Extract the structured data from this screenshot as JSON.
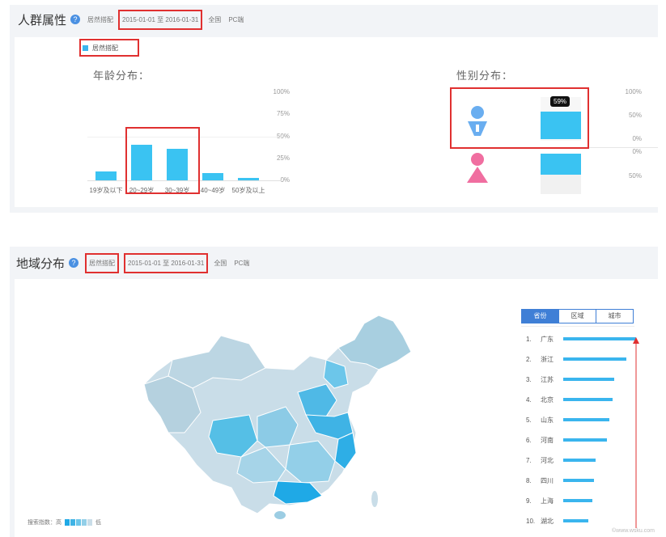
{
  "crowd": {
    "title": "人群属性",
    "help_icon": "question-icon",
    "keyword": "居然搭配",
    "date_range": "2015-01-01 至 2016-01-31",
    "region": "全国",
    "platform": "PC端",
    "legend": "居然搭配"
  },
  "age": {
    "section_title": "年龄分布：",
    "y_ticks": [
      "100%",
      "75%",
      "50%",
      "25%",
      "0%"
    ],
    "chart_data": {
      "type": "bar",
      "categories": [
        "19岁及以下",
        "20~29岁",
        "30~39岁",
        "40~49岁",
        "50岁及以上"
      ],
      "values": [
        10,
        40,
        36,
        8,
        3
      ],
      "ylim": [
        0,
        100
      ]
    }
  },
  "gender": {
    "section_title": "性别分布：",
    "y_ticks_top": [
      "100%",
      "50%",
      "0%"
    ],
    "y_ticks_bottom": [
      "0%",
      "50%"
    ],
    "tooltip": "59%",
    "male_share": 59,
    "icons": [
      "male-icon",
      "female-icon"
    ],
    "colors": {
      "male": "#6aaef0",
      "female": "#f06ea0",
      "bar": "#3ac3f2"
    }
  },
  "region": {
    "title": "地域分布",
    "help_icon": "question-icon",
    "keyword": "居然搭配",
    "date_range": "2015-01-01 至 2016-01-31",
    "region": "全国",
    "platform": "PC端",
    "map_legend_label": "搜索指数：高",
    "map_legend_low": "低",
    "tabs": [
      "省份",
      "区域",
      "城市"
    ],
    "active_tab": 0,
    "ranking": [
      {
        "rank": "1.",
        "name": "广东",
        "share": 0.95
      },
      {
        "rank": "2.",
        "name": "浙江",
        "share": 0.82
      },
      {
        "rank": "3.",
        "name": "江苏",
        "share": 0.66
      },
      {
        "rank": "4.",
        "name": "北京",
        "share": 0.64
      },
      {
        "rank": "5.",
        "name": "山东",
        "share": 0.6
      },
      {
        "rank": "6.",
        "name": "河南",
        "share": 0.57
      },
      {
        "rank": "7.",
        "name": "河北",
        "share": 0.42
      },
      {
        "rank": "8.",
        "name": "四川",
        "share": 0.4
      },
      {
        "rank": "9.",
        "name": "上海",
        "share": 0.38
      },
      {
        "rank": "10.",
        "name": "湖北",
        "share": 0.33
      }
    ]
  },
  "watermark": "©www.wsku.com"
}
